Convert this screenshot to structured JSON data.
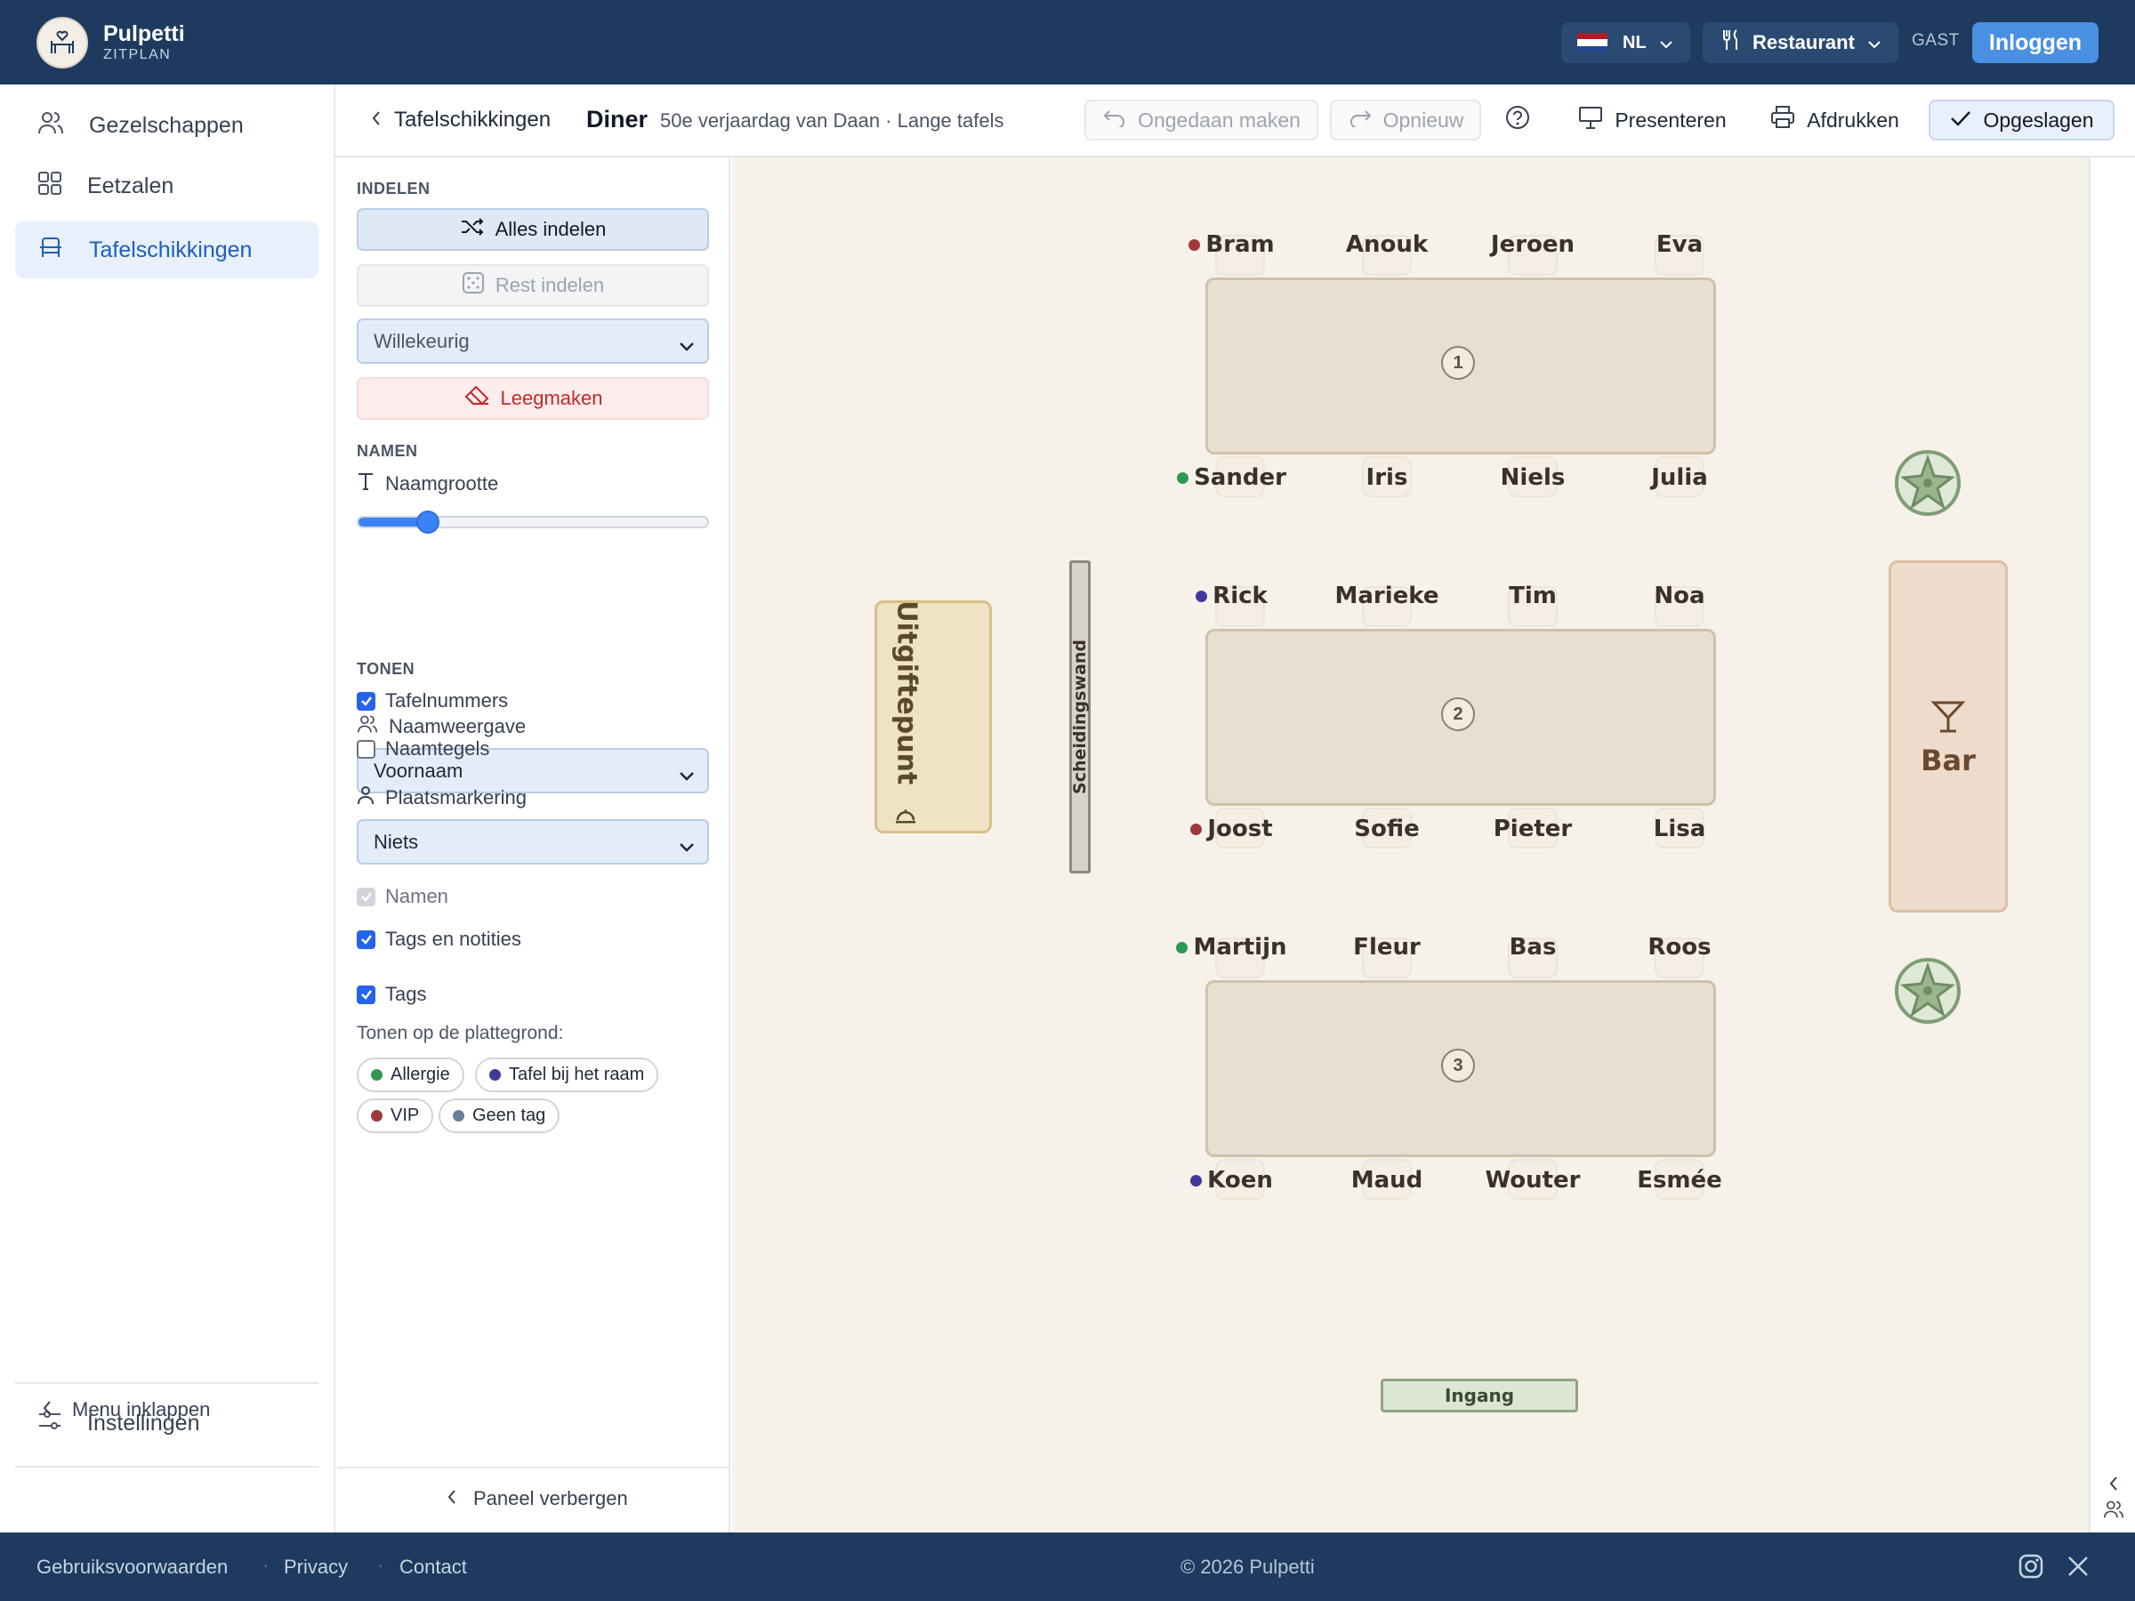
{
  "brand": {
    "name": "Pulpetti",
    "sub": "ZITPLAN"
  },
  "topbar": {
    "language": "NL",
    "mode": "Restaurant",
    "guest_label": "GAST",
    "login_label": "Inloggen"
  },
  "nav": {
    "items": [
      {
        "label": "Gezelschappen",
        "icon": "people-icon"
      },
      {
        "label": "Eetzalen",
        "icon": "grid-icon"
      },
      {
        "label": "Tafelschikkingen",
        "icon": "table-icon",
        "active": true
      }
    ],
    "settings": "Instellingen",
    "collapse": "Menu inklappen"
  },
  "subheader": {
    "back_label": "Tafelschikkingen",
    "title": "Diner",
    "subtitle": "50e verjaardag van Daan · Lange tafels",
    "undo": "Ongedaan maken",
    "redo": "Opnieuw",
    "present": "Presenteren",
    "print": "Afdrukken",
    "saved": "Opgeslagen"
  },
  "panel": {
    "section_indelen": "INDELEN",
    "alles_indelen": "Alles indelen",
    "rest_indelen": "Rest indelen",
    "method": "Willekeurig",
    "clear": "Leegmaken",
    "section_namen": "NAMEN",
    "name_size_label": "Naamgrootte",
    "name_size_value": 0.2,
    "name_display_label": "Naamweergave",
    "name_display_value": "Voornaam",
    "section_tonen": "TONEN",
    "cb_tafelnummers": "Tafelnummers",
    "cb_naamtegels": "Naamtegels",
    "plaatsmarkering_label": "Plaatsmarkering",
    "plaatsmarkering_value": "Niets",
    "cb_namen": "Namen",
    "cb_tags_notities": "Tags en notities",
    "cb_tags": "Tags",
    "show_on_plan": "Tonen op de plattegrond:",
    "tags": [
      {
        "label": "Allergie",
        "color": "#2e9a4f"
      },
      {
        "label": "Tafel bij het raam",
        "color": "#3f3a9a"
      },
      {
        "label": "VIP",
        "color": "#a03a3a"
      },
      {
        "label": "Geen tag",
        "color": "#6b7f9a"
      }
    ],
    "hide_panel": "Paneel verbergen"
  },
  "floorplan": {
    "tables": [
      {
        "number": "1",
        "top": [
          "Bram",
          "Anouk",
          "Jeroen",
          "Eva"
        ],
        "bottom": [
          "Sander",
          "Iris",
          "Niels",
          "Julia"
        ]
      },
      {
        "number": "2",
        "top": [
          "Rick",
          "Marieke",
          "Tim",
          "Noa"
        ],
        "bottom": [
          "Joost",
          "Sofie",
          "Pieter",
          "Lisa"
        ]
      },
      {
        "number": "3",
        "top": [
          "Martijn",
          "Fleur",
          "Bas",
          "Roos"
        ],
        "bottom": [
          "Koen",
          "Maud",
          "Wouter",
          "Esmée"
        ]
      }
    ],
    "tag_markers": [
      {
        "guest": "Bram",
        "color": "#a03a3a"
      },
      {
        "guest": "Sander",
        "color": "#2e9a4f"
      },
      {
        "guest": "Rick",
        "color": "#3f3a9a"
      },
      {
        "guest": "Joost",
        "color": "#a03a3a"
      },
      {
        "guest": "Martijn",
        "color": "#2e9a4f"
      },
      {
        "guest": "Koen",
        "color": "#3f3a9a"
      }
    ],
    "serving_point": "Uitgiftepunt",
    "partition": "Scheidingswand",
    "bar": "Bar",
    "entrance": "Ingang"
  },
  "footer": {
    "terms": "Gebruiksvoorwaarden",
    "privacy": "Privacy",
    "contact": "Contact",
    "copyright": "© 2026 Pulpetti"
  }
}
